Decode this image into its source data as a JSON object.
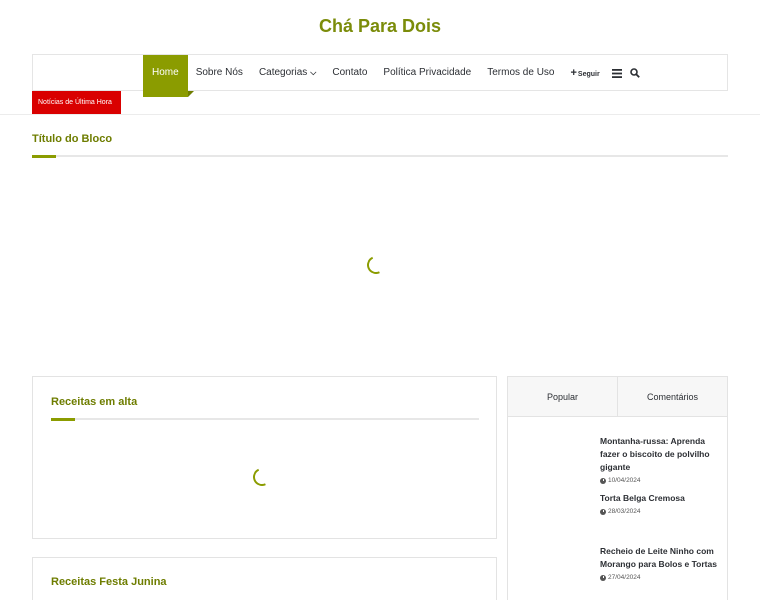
{
  "site": {
    "title": "Chá Para Dois"
  },
  "nav": {
    "items": [
      "Home",
      "Sobre Nós",
      "Categorias",
      "Contato",
      "Política Privacidade",
      "Termos de Uso"
    ],
    "follow_label": "Seguir",
    "menu_icon": "hamburger-icon",
    "search_icon": "search-icon"
  },
  "breaking": {
    "label": "Notícias de Última Hora"
  },
  "block": {
    "title": "Título do Bloco"
  },
  "trending": {
    "title": "Receitas em alta"
  },
  "festa": {
    "title": "Receitas Festa Junina"
  },
  "tabs": {
    "popular": "Popular",
    "comments": "Comentários"
  },
  "posts": [
    {
      "title": "Montanha-russa: Aprenda fazer o biscoito de polvilho gigante",
      "date": "10/04/2024"
    },
    {
      "title": "Torta Belga Cremosa",
      "date": "28/03/2024"
    },
    {
      "title": "Recheio de Leite Ninho com Morango para Bolos e Tortas",
      "date": "27/04/2024"
    }
  ],
  "colors": {
    "accent": "#8b9c00",
    "breaking": "#d90000"
  }
}
